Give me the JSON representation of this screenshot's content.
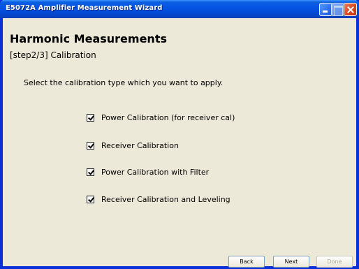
{
  "window": {
    "title": "E5072A Amplifier Measurement Wizard",
    "title_bar_color": "#0a5fe0",
    "controls": {
      "minimize": "minimize-icon",
      "maximize": "maximize-icon",
      "close": "close-icon"
    }
  },
  "page": {
    "heading": "Harmonic Measurements",
    "step": "[step2/3] Calibration",
    "instruction": "Select the calibration type which you want to apply."
  },
  "options": [
    {
      "label": "Power Calibration (for receiver cal)",
      "checked": true
    },
    {
      "label": "Receiver Calibration",
      "checked": true
    },
    {
      "label": "Power Calibration with Filter",
      "checked": true
    },
    {
      "label": "Receiver Calibration and Leveling",
      "checked": true
    }
  ],
  "buttons": {
    "back": "Back",
    "next": "Next",
    "done": "Done",
    "done_enabled": false
  }
}
